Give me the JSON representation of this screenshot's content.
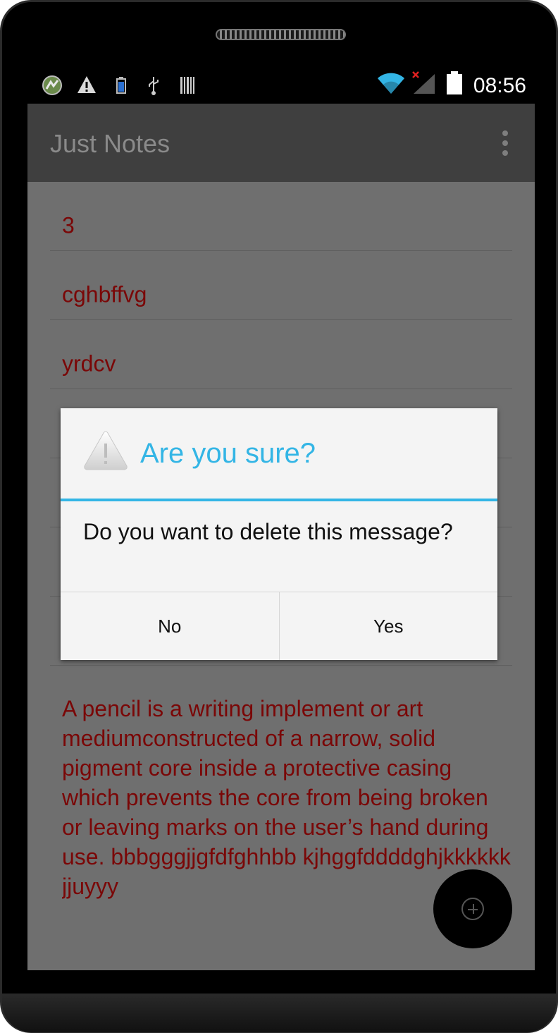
{
  "status_bar": {
    "time": "08:56",
    "left_icons": [
      "app-badge-icon",
      "warning-icon",
      "battery-small-icon",
      "usb-icon",
      "barcode-icon"
    ],
    "right_icons": [
      "wifi-icon",
      "no-signal-icon",
      "battery-icon"
    ]
  },
  "app": {
    "title": "Just Notes"
  },
  "notes": [
    {
      "text": "3"
    },
    {
      "text": "cghbffvg"
    },
    {
      "text": "yrdcv"
    },
    {
      "text": ""
    },
    {
      "text": ""
    },
    {
      "text": ""
    },
    {
      "text": ""
    }
  ],
  "long_note": {
    "text": "A pencil is a writing implement or art mediumconstructed of a narrow, solid pigment core inside a protective casing which prevents the core from being broken or leaving marks on the user’s hand during use. bbbgggjjgfdfghhbb kjhggfddddghjkkkkkk jjuyyy"
  },
  "dialog": {
    "title": "Are you sure?",
    "message": "Do you want to delete this message?",
    "no_label": "No",
    "yes_label": "Yes"
  },
  "colors": {
    "accent": "#33b5e5",
    "note_text": "#7a0707",
    "dim_background": "#6f6f6f",
    "action_bar": "#3f3f3f"
  }
}
